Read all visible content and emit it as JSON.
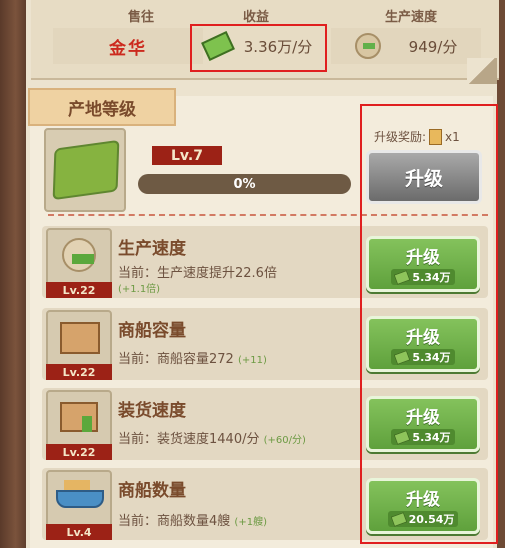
{
  "stats": {
    "headers": [
      "售往",
      "收益",
      "生产速度"
    ],
    "destination": "金华",
    "income": "3.36万/分",
    "speed": "949/分"
  },
  "section_title": "产地等级",
  "origin": {
    "level": "Lv.7",
    "progress": "0%",
    "progress_value": 0,
    "reward_label": "升级奖励:",
    "reward_count": "x1",
    "upgrade_label": "升级"
  },
  "items": [
    {
      "title": "生产速度",
      "level": "Lv.22",
      "desc": "当前：生产速度提升22.6倍",
      "inc": "(+1.1倍)",
      "btn": "升级",
      "cost": "5.34万",
      "icon": "production-icon"
    },
    {
      "title": "商船容量",
      "level": "Lv.22",
      "desc": "当前：商船容量272",
      "inc": "(+11)",
      "btn": "升级",
      "cost": "5.34万",
      "icon": "cargo-box-icon"
    },
    {
      "title": "装货速度",
      "level": "Lv.22",
      "desc": "当前：装货速度1440/分",
      "inc": "(+60/分)",
      "btn": "升级",
      "cost": "5.34万",
      "icon": "loading-speed-icon"
    },
    {
      "title": "商船数量",
      "level": "Lv.4",
      "desc": "当前：商船数量4艘",
      "inc": "(+1艘)",
      "btn": "升级",
      "cost": "20.54万",
      "icon": "ship-icon"
    }
  ]
}
